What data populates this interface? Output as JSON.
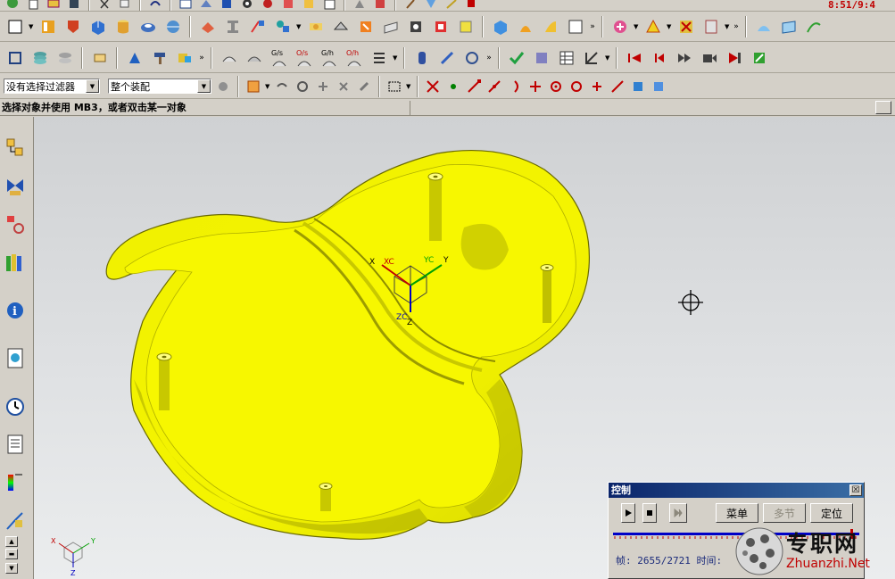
{
  "clock": "8:51/9:4",
  "filters": {
    "selection_filter": "没有选择过滤器",
    "assembly_scope": "整个装配"
  },
  "toolbar_text": {
    "gs": "G/s",
    "os": "O/s",
    "gh": "G/h",
    "oh": "O/h"
  },
  "status": {
    "prompt": "选择对象并使用 MB3，或者双击某一对象"
  },
  "wcs_labels": {
    "x": "X",
    "xc": "XC",
    "yc": "YC",
    "y": "Y",
    "zc": "ZC",
    "z": "Z"
  },
  "mini_triad": {
    "x": "X",
    "y": "Y",
    "z": "Z"
  },
  "model": {
    "color": "#f0f000",
    "shade": "#9a9a00",
    "highlight": "#ffff8a"
  },
  "control_panel": {
    "title": "控制",
    "close": "☒",
    "buttons": {
      "menu": "菜单",
      "chapter": "多节",
      "locate": "定位"
    },
    "frame_label": "帧:",
    "frame_value": "2655/2721",
    "time_label": "时间:",
    "progress": 0.976
  },
  "watermark": {
    "name_cn": "专职网",
    "url": "Zhuanzhi.Net"
  },
  "icons": [
    "new-file-icon",
    "open-folder-icon",
    "save-icon",
    "cut-icon",
    "copy-icon",
    "paste-icon",
    "undo-icon",
    "sketch-icon",
    "extrude-icon",
    "revolve-icon",
    "block-icon",
    "cylinder-icon",
    "cone-icon",
    "layer-icon",
    "selection-icon",
    "analysis-icon",
    "play-first-icon",
    "play-back-icon",
    "play-forward-icon",
    "record-icon"
  ]
}
